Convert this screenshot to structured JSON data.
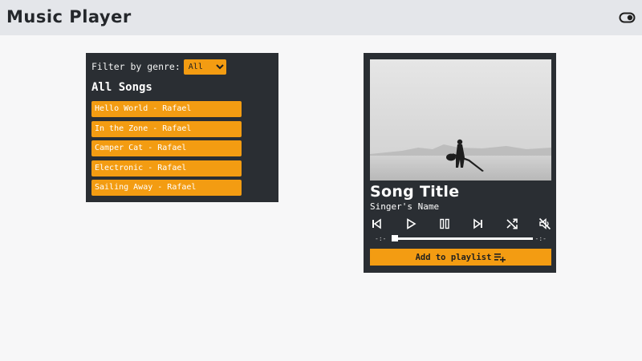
{
  "header": {
    "title": "Music Player",
    "theme_toggle_icon": "toggle-icon"
  },
  "playlist": {
    "filter_label": "Filter by genre:",
    "genre_selected": "All",
    "heading": "All Songs",
    "songs": [
      "Hello World - Rafael",
      "In the Zone - Rafael",
      "Camper Cat - Rafael",
      "Electronic - Rafael",
      "Sailing Away - Rafael"
    ]
  },
  "player": {
    "song_title": "Song Title",
    "singer_name": "Singer's Name",
    "time_current": "-:-",
    "time_total": "-:-",
    "progress": 0.0,
    "add_label": "Add to playlist",
    "controls": [
      "previous-icon",
      "play-icon",
      "pause-icon",
      "next-icon",
      "shuffle-icon",
      "mute-icon"
    ]
  },
  "colors": {
    "accent": "#f39c12",
    "panel": "#2a2e33",
    "header": "#e4e6ea",
    "background": "#f7f7f8"
  }
}
